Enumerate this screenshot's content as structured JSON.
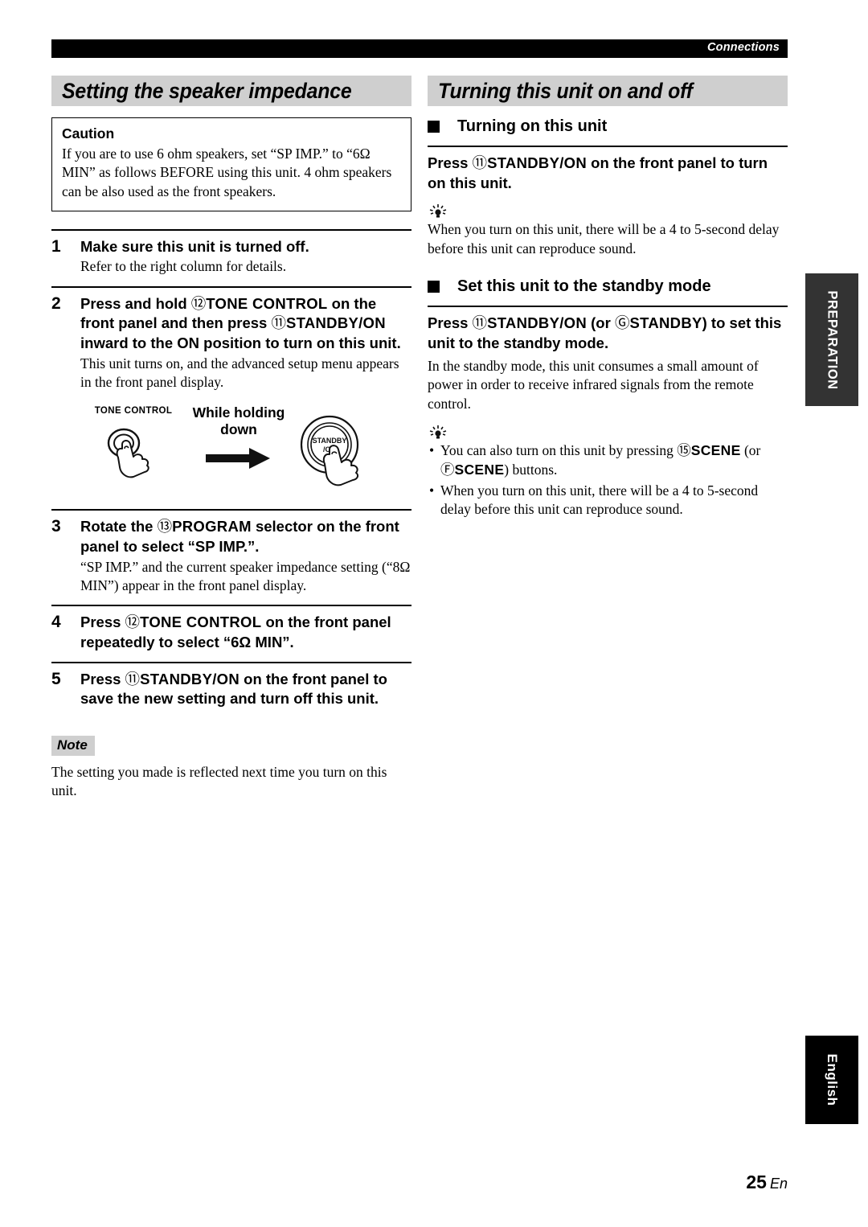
{
  "running_head": {
    "label": "Connections"
  },
  "left_column": {
    "section_title": "Setting the speaker impedance",
    "caution": {
      "title": "Caution",
      "text": "If you are to use 6 ohm speakers, set “SP IMP.” to “6Ω MIN” as follows BEFORE using this unit. 4 ohm speakers can be also used as the front speakers."
    },
    "steps": [
      {
        "num": "1",
        "head_parts": [
          {
            "type": "plain",
            "text": "Make sure this unit is turned off."
          }
        ],
        "desc": "Refer to the right column for details."
      },
      {
        "num": "2",
        "head_parts": [
          {
            "type": "plain",
            "text": "Press and hold "
          },
          {
            "type": "circled",
            "text": "⑫"
          },
          {
            "type": "kbd",
            "text": "TONE CONTROL"
          },
          {
            "type": "plain",
            "text": " on the front panel and then press "
          },
          {
            "type": "circled",
            "text": "⑪"
          },
          {
            "type": "kbd",
            "text": "STANDBY/ON"
          },
          {
            "type": "plain",
            "text": " inward to the ON position to turn on this unit."
          }
        ],
        "desc": "This unit turns on, and the advanced setup menu appears in the front panel display."
      },
      {
        "num": "3",
        "head_parts": [
          {
            "type": "plain",
            "text": "Rotate the "
          },
          {
            "type": "circled",
            "text": "⑬"
          },
          {
            "type": "kbd",
            "text": "PROGRAM"
          },
          {
            "type": "plain",
            "text": " selector on the front panel to select “SP IMP.”."
          }
        ],
        "desc": "“SP IMP.” and the current speaker impedance setting (“8Ω MIN”) appear in the front panel display."
      },
      {
        "num": "4",
        "head_parts": [
          {
            "type": "plain",
            "text": "Press "
          },
          {
            "type": "circled",
            "text": "⑫"
          },
          {
            "type": "kbd",
            "text": "TONE CONTROL"
          },
          {
            "type": "plain",
            "text": " on the front panel repeatedly to select “6Ω MIN”."
          }
        ],
        "desc": ""
      },
      {
        "num": "5",
        "head_parts": [
          {
            "type": "plain",
            "text": "Press "
          },
          {
            "type": "circled",
            "text": "⑪"
          },
          {
            "type": "kbd",
            "text": "STANDBY/ON"
          },
          {
            "type": "plain",
            "text": " on the front panel to save the new setting and turn off this unit."
          }
        ],
        "desc": ""
      }
    ],
    "illustration": {
      "tone_control_label": "TONE CONTROL",
      "while_holding_line1": "While holding",
      "while_holding_line2": "down",
      "standby_label_line1": "STANDBY",
      "standby_label_line2": "/ON"
    },
    "note": {
      "tag": "Note",
      "text": "The setting you made is reflected next time you turn on this unit."
    }
  },
  "right_column": {
    "section_title": "Turning this unit on and off",
    "subsections": [
      {
        "heading": "Turning on this unit",
        "lead_parts": [
          {
            "type": "plain",
            "text": "Press "
          },
          {
            "type": "circled",
            "text": "⑪"
          },
          {
            "type": "kbd",
            "text": "STANDBY/ON"
          },
          {
            "type": "plain",
            "text": " on the front panel to turn on this unit."
          }
        ],
        "body": "",
        "tips": [
          "When you turn on this unit, there will be a 4 to 5-second delay before this unit can reproduce sound."
        ],
        "tips_as_bullets": false
      },
      {
        "heading": "Set this unit to the standby mode",
        "lead_parts": [
          {
            "type": "plain",
            "text": "Press "
          },
          {
            "type": "circled",
            "text": "⑪"
          },
          {
            "type": "kbd",
            "text": "STANDBY/ON"
          },
          {
            "type": "plain",
            "text": " (or "
          },
          {
            "type": "circled",
            "text": "Ⓖ"
          },
          {
            "type": "kbd",
            "text": "STANDBY"
          },
          {
            "type": "plain",
            "text": ") to set this unit to the standby mode."
          }
        ],
        "body": "In the standby mode, this unit consumes a small amount of power in order to receive infrared signals from the remote control.",
        "tips_parts": [
          [
            {
              "type": "plain",
              "text": "You can also turn on this unit by pressing "
            },
            {
              "type": "circled",
              "text": "⑮"
            },
            {
              "type": "kbd",
              "text": "SCENE"
            },
            {
              "type": "plain",
              "text": " (or "
            },
            {
              "type": "circled",
              "text": "Ⓕ"
            },
            {
              "type": "kbd",
              "text": "SCENE"
            },
            {
              "type": "plain",
              "text": ") buttons."
            }
          ],
          [
            {
              "type": "plain",
              "text": "When you turn on this unit, there will be a 4 to 5-second delay before this unit can reproduce sound."
            }
          ]
        ],
        "tips_as_bullets": true
      }
    ]
  },
  "side_tabs": {
    "preparation": "PREPARATION",
    "english": "English"
  },
  "page": {
    "number": "25",
    "suffix": "En"
  },
  "colors": {
    "header_bar": "#000000",
    "section_bar": "#cfcfcf",
    "tab_preparation": "#333333",
    "tab_english": "#000000",
    "text": "#000000"
  }
}
